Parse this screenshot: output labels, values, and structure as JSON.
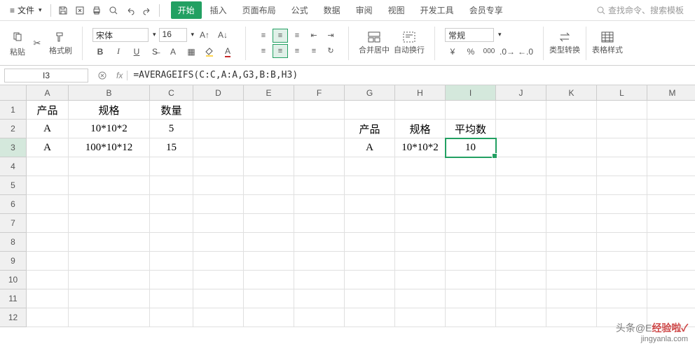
{
  "menu": {
    "file_label": "文件",
    "tabs": [
      "开始",
      "插入",
      "页面布局",
      "公式",
      "数据",
      "审阅",
      "视图",
      "开发工具",
      "会员专享"
    ],
    "search_placeholder": "查找命令、搜索模板"
  },
  "ribbon": {
    "paste_label": "粘贴",
    "format_painter": "格式刷",
    "font_name": "宋体",
    "font_size": "16",
    "merge_label": "合并居中",
    "wrap_label": "自动换行",
    "number_format": "常规",
    "type_convert": "类型转换",
    "table_style": "表格样式"
  },
  "formula_bar": {
    "cell_ref": "I3",
    "formula": "=AVERAGEIFS(C:C,A:A,G3,B:B,H3)"
  },
  "columns": [
    "A",
    "B",
    "C",
    "D",
    "E",
    "F",
    "G",
    "H",
    "I",
    "J",
    "K",
    "L",
    "M"
  ],
  "rows": [
    "1",
    "2",
    "3",
    "4",
    "5",
    "6",
    "7",
    "8",
    "9",
    "10",
    "11",
    "12"
  ],
  "cells": {
    "A1": "产品",
    "B1": "规格",
    "C1": "数量",
    "A2": "A",
    "B2": "10*10*2",
    "C2": "5",
    "A3": "A",
    "B3": "100*10*12",
    "C3": "15",
    "G2": "产品",
    "H2": "规格",
    "I2": "平均数",
    "G3": "A",
    "H3": "10*10*2",
    "I3": "10"
  },
  "selected": "I3",
  "watermark": {
    "line1_prefix": "头条@E",
    "brand": "经验啦",
    "sub": "jingyanla.com"
  }
}
